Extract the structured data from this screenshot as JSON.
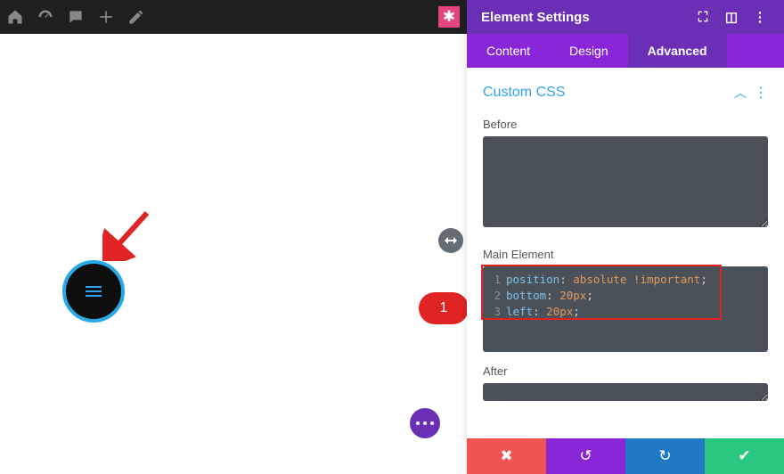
{
  "topbar": {
    "icons": [
      "home-icon",
      "dashboard-icon",
      "comment-icon",
      "plus-icon",
      "pencil-icon"
    ],
    "badge": "✱"
  },
  "canvas": {
    "menu_button_label": "menu"
  },
  "annotations": {
    "callout_number": "1"
  },
  "panel": {
    "title": "Element Settings",
    "header_icons": [
      "expand-icon",
      "columns-icon",
      "more-icon"
    ],
    "tabs": [
      {
        "label": "Content",
        "active": false
      },
      {
        "label": "Design",
        "active": false
      },
      {
        "label": "Advanced",
        "active": true
      }
    ],
    "section_title": "Custom CSS",
    "fields": {
      "before": {
        "label": "Before",
        "value": ""
      },
      "main": {
        "label": "Main Element",
        "code": [
          {
            "n": "1",
            "prop": "position",
            "value": "absolute !important"
          },
          {
            "n": "2",
            "prop": "bottom",
            "value": "20px"
          },
          {
            "n": "3",
            "prop": "left",
            "value": "20px"
          }
        ]
      },
      "after": {
        "label": "After",
        "value": ""
      }
    },
    "footer": {
      "cancel": "✖",
      "undo": "↺",
      "redo": "↻",
      "save": "✔"
    }
  }
}
